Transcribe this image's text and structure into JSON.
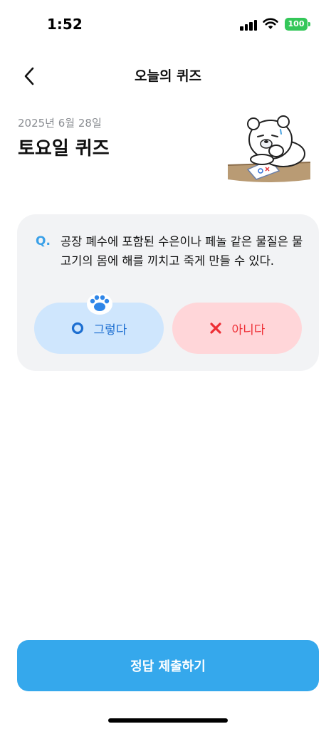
{
  "status_bar": {
    "time": "1:52",
    "battery": "100",
    "battery_color": "#34c759"
  },
  "header": {
    "title": "오늘의 퀴즈",
    "back_icon": "chevron-left-icon"
  },
  "quiz": {
    "date": "2025년 6월 28일",
    "title": "토요일 퀴즈",
    "mascot": "polar-bear-ox-mascot"
  },
  "question": {
    "marker": "Q.",
    "text": "공장 폐수에 포함된 수은이나 페놀 같은 물질은 물고기의 몸에 해를 끼치고 죽게 만들 수 있다."
  },
  "answers": {
    "yes": {
      "label": "그렇다",
      "icon": "circle-o-icon",
      "color": "#1d6fd1",
      "background": "#cfe6fd"
    },
    "no": {
      "label": "아니다",
      "icon": "x-mark-icon",
      "color": "#ee2e35",
      "background": "#ffd6d9"
    },
    "pointer_icon": "paw-icon"
  },
  "submit": {
    "label": "정답 제출하기",
    "color": "#35a8ec"
  }
}
